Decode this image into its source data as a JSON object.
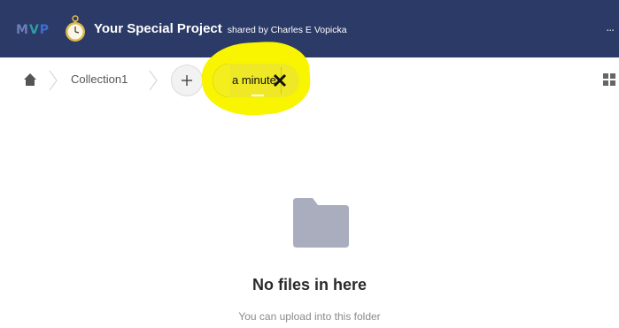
{
  "header": {
    "logo_text": "MVP",
    "title": "Your Special Project",
    "shared_by": "shared by Charles E Vopicka",
    "more_label": "..."
  },
  "breadcrumb": {
    "items": [
      {
        "label": "Collection1"
      }
    ]
  },
  "new_item_chip": {
    "value": "a minute"
  },
  "empty_state": {
    "title": "No files in here",
    "subtitle": "You can upload into this folder"
  },
  "colors": {
    "header_bg": "#2b3a66",
    "highlight": "#f9f400",
    "folder_icon": "#a9adbd"
  },
  "icons": [
    "pocket-watch-icon",
    "more-icon",
    "home-icon",
    "chevron-right-icon",
    "plus-icon",
    "close-icon",
    "grid-view-icon",
    "folder-icon"
  ]
}
